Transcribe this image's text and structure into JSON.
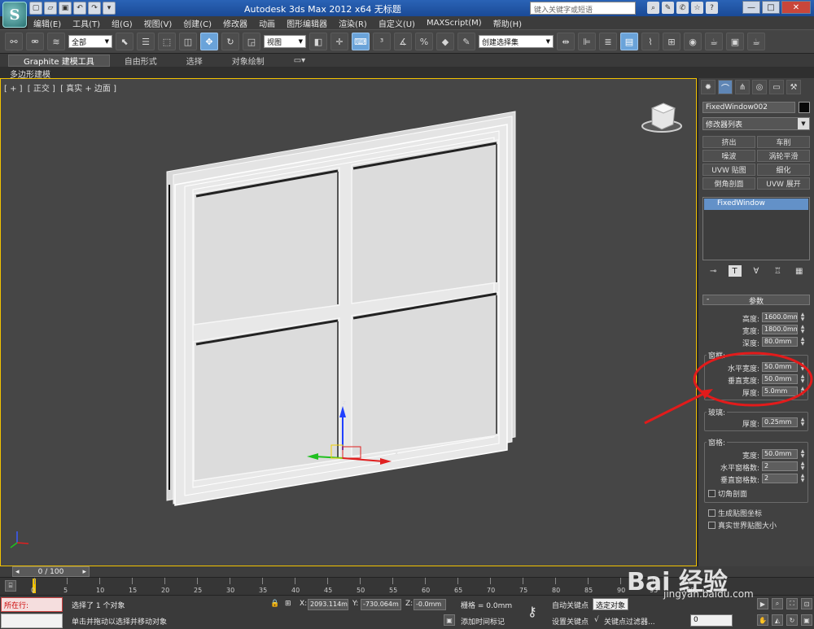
{
  "window": {
    "app_logo": "S",
    "title": "Autodesk 3ds Max  2012 x64     无标题",
    "search_placeholder": "键入关键字或短语",
    "controls": [
      "—",
      "□",
      "✕"
    ]
  },
  "quick_access": [
    "▢",
    "▱",
    "▣",
    "↶",
    "↷",
    "▾"
  ],
  "menu": [
    "编辑(E)",
    "工具(T)",
    "组(G)",
    "视图(V)",
    "创建(C)",
    "修改器",
    "动画",
    "图形编辑器",
    "渲染(R)",
    "自定义(U)",
    "MAXScript(M)",
    "帮助(H)"
  ],
  "toolbar": {
    "selection_filter": "全部",
    "ref_coord": "视图",
    "named_selection": "创建选择集"
  },
  "ribbon": {
    "tabs": [
      "Graphite 建模工具",
      "自由形式",
      "选择",
      "对象绘制"
    ],
    "active_tab": 0,
    "sub_label": "多边形建模"
  },
  "viewport": {
    "label_parts": [
      "[ + ]",
      "[ 正交 ]",
      "[ 真实 + 边面 ]"
    ],
    "gizmo_axes": [
      "x",
      "y",
      "z"
    ]
  },
  "command_panel": {
    "object_name": "FixedWindow002",
    "modifier_list": "修改器列表",
    "modifier_buttons": [
      "挤出",
      "车削",
      "噪波",
      "涡轮平滑",
      "UVW 贴图",
      "细化",
      "倒角剖面",
      "UVW 展开"
    ],
    "stack_items": [
      "FixedWindow"
    ],
    "rollout_title": "参数",
    "params_main": [
      {
        "label": "高度:",
        "value": "1600.0mm"
      },
      {
        "label": "宽度:",
        "value": "1800.0mm"
      },
      {
        "label": "深度:",
        "value": "80.0mm"
      }
    ],
    "frame_group": "窗框:",
    "frame_params": [
      {
        "label": "水平宽度:",
        "value": "50.0mm"
      },
      {
        "label": "垂直宽度:",
        "value": "50.0mm"
      },
      {
        "label": "厚度:",
        "value": "5.0mm"
      }
    ],
    "glass_group": "玻璃:",
    "glass_params": [
      {
        "label": "厚度:",
        "value": "0.25mm"
      }
    ],
    "sash_group": "窗格:",
    "sash_params": [
      {
        "label": "宽度:",
        "value": "50.0mm"
      },
      {
        "label": "水平窗格数:",
        "value": "2"
      },
      {
        "label": "垂直窗格数:",
        "value": "2"
      }
    ],
    "chamfer_label": "切角剖面",
    "gen_map_coords": "生成贴图坐标",
    "real_world_map": "真实世界贴图大小"
  },
  "timeline": {
    "frame_display": "0 / 100",
    "ticks": [
      "0",
      "5",
      "10",
      "15",
      "20",
      "25",
      "30",
      "35",
      "40",
      "45",
      "50",
      "55",
      "60",
      "65",
      "70",
      "75",
      "80",
      "85",
      "90",
      "95",
      "100"
    ]
  },
  "status": {
    "running_label": "所在行:",
    "selection": "选择了 1 个对象",
    "prompt": "单击并拖动以选择并移动对象",
    "x": "2093.114m",
    "y": "-730.064m",
    "z": "-0.0mm",
    "grid": "栅格 = 0.0mm",
    "auto_key": "自动关键点",
    "selected": "选定对象",
    "set_key": "设置关键点",
    "key_filters": "关键点过滤器...",
    "add_time_tag": "添加时间标记",
    "frame_field": "0"
  },
  "watermark": {
    "text": "Bai 经验",
    "sub": "jingyan.baidu.com"
  },
  "colors": {
    "viewport_bg": "#464646",
    "viewport_border": "#f2c200",
    "highlight_circle": "#e21b1b",
    "selected_stack": "#6391c8"
  }
}
